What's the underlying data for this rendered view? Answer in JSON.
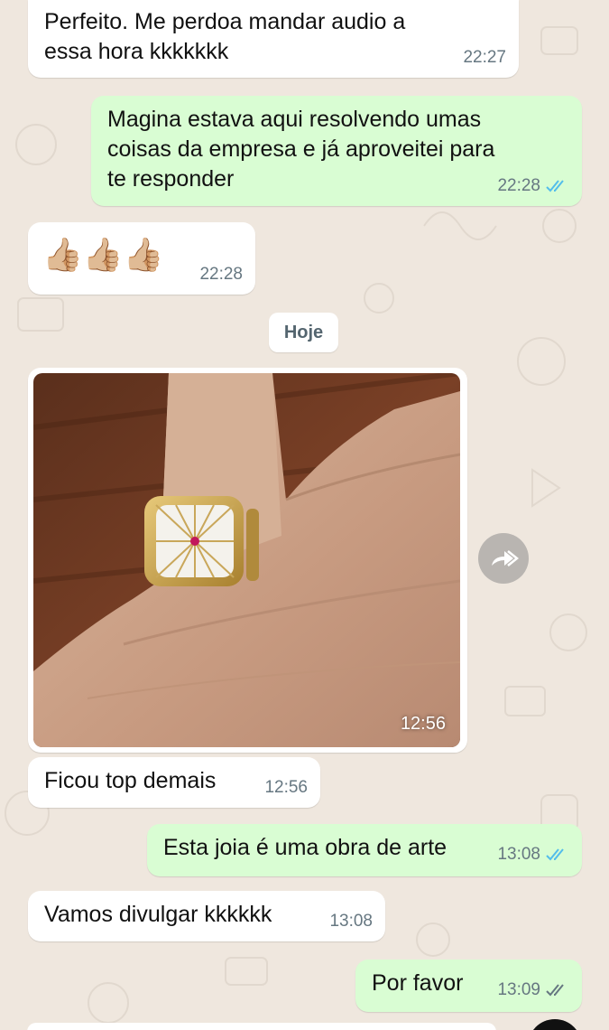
{
  "messages": [
    {
      "id": "m1",
      "direction": "incoming",
      "text": "Perfeito. Me perdoa mandar audio a\nessa hora kkkkkkk",
      "time": "22:27"
    },
    {
      "id": "m2",
      "direction": "outgoing",
      "text": "Magina estava aqui resolvendo umas\ncoisas da empresa e já aproveitei para\nte responder",
      "time": "22:28",
      "status": "read"
    },
    {
      "id": "m3",
      "direction": "incoming",
      "emoji": "👍🏼👍🏼👍🏼",
      "time": "22:28"
    },
    {
      "id": "m4",
      "direction": "incoming",
      "type": "image",
      "image_alt": "hand-with-gold-ring-photo",
      "time": "12:56"
    },
    {
      "id": "m5",
      "direction": "incoming",
      "text": "Ficou top demais",
      "time": "12:56"
    },
    {
      "id": "m6",
      "direction": "outgoing",
      "text": "Esta joia é uma obra de arte",
      "time": "13:08",
      "status": "read"
    },
    {
      "id": "m7",
      "direction": "incoming",
      "text": "Vamos divulgar kkkkkk",
      "time": "13:08"
    },
    {
      "id": "m8",
      "direction": "outgoing",
      "text": "Por favor",
      "time": "13:09",
      "status": "delivered"
    }
  ],
  "day_divider": "Hoje",
  "colors": {
    "incoming_bubble": "#ffffff",
    "outgoing_bubble": "#d9fdd3",
    "read_ticks": "#53bdeb",
    "delivered_ticks": "#667781",
    "wallpaper": "#efe7de"
  },
  "icons": {
    "forward": "forward-icon",
    "read_receipt": "double-check-icon"
  }
}
